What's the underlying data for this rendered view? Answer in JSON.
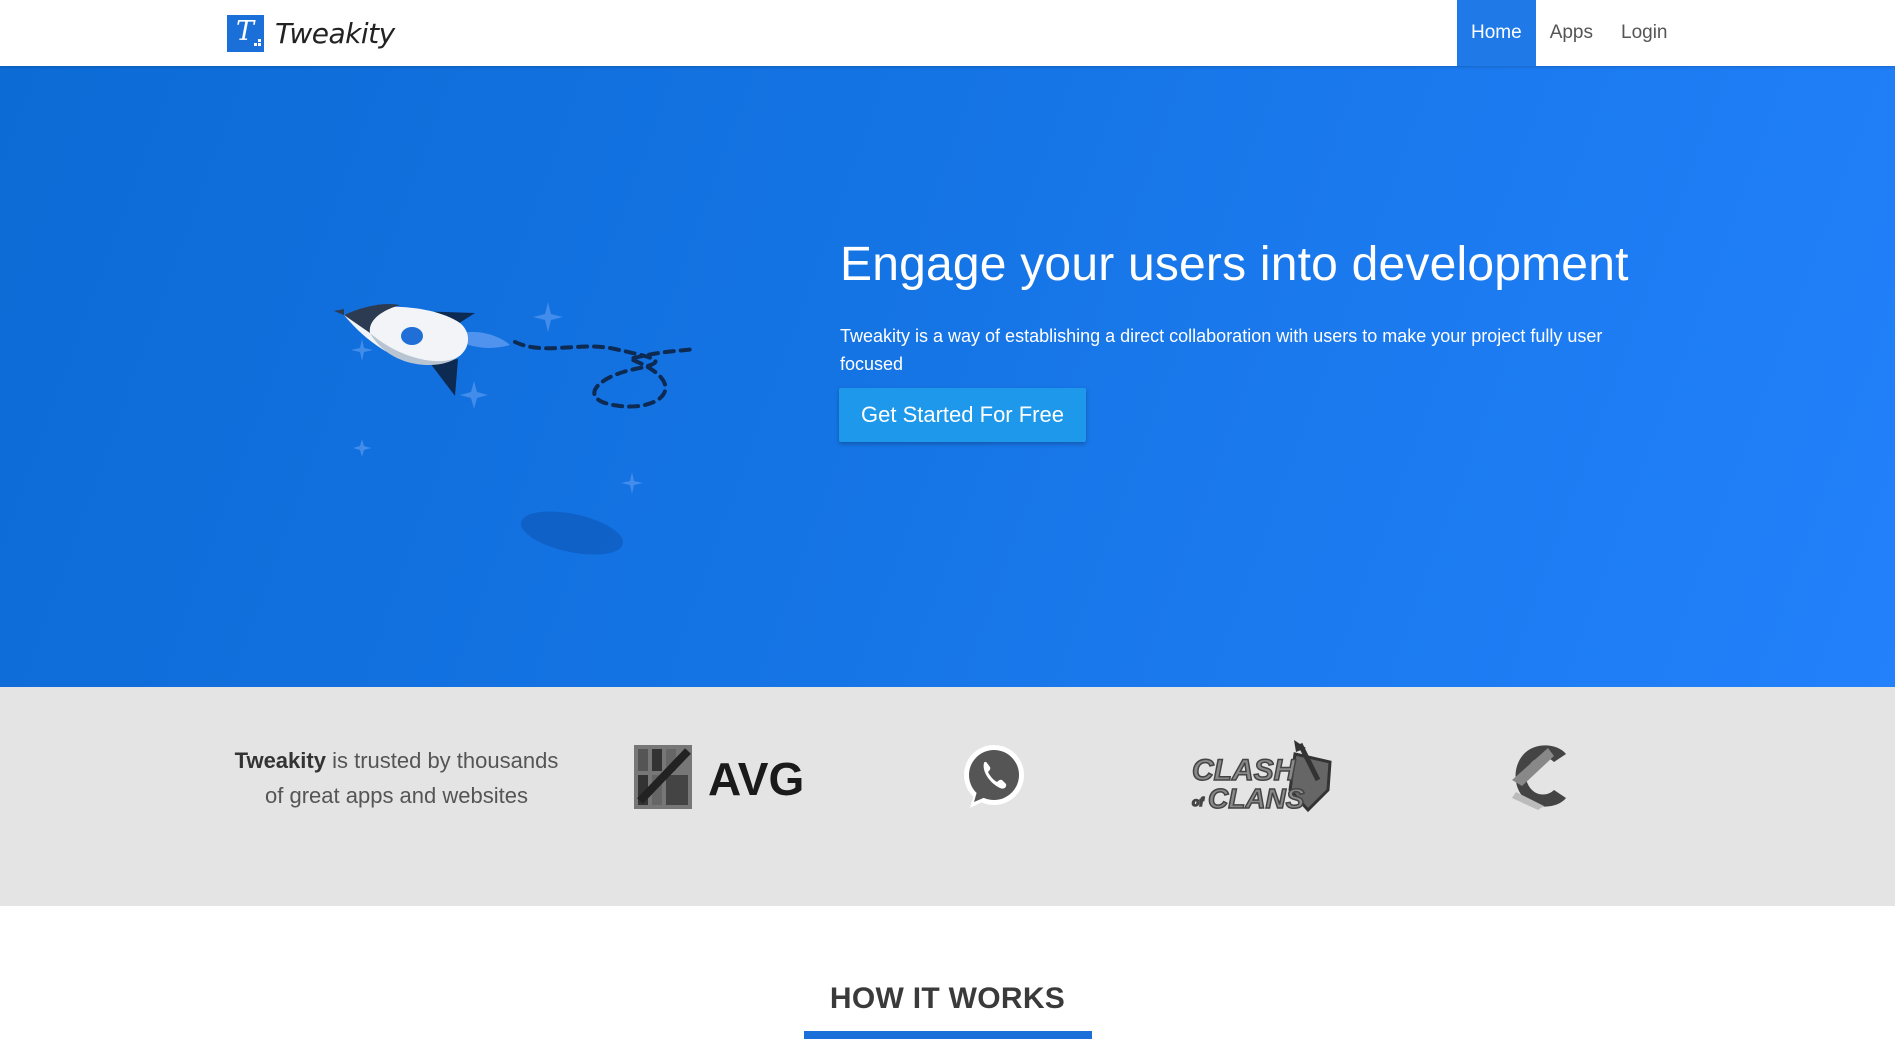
{
  "navbar": {
    "brand_mark": "T",
    "brand_name": "Tweakity",
    "items": [
      {
        "label": "Home",
        "active": true
      },
      {
        "label": "Apps",
        "active": false
      },
      {
        "label": "Login",
        "active": false
      }
    ]
  },
  "hero": {
    "title": "Engage your users into development",
    "subtitle": "Tweakity is a way of establishing a direct collaboration with users to make your project fully user focused",
    "cta_label": "Get Started For Free",
    "illustration": "rocket-illustration"
  },
  "trusted": {
    "brand": "Tweakity",
    "text": " is trusted by thousands of great apps and websites",
    "logos": [
      {
        "name": "avg-logo",
        "label": "AVG"
      },
      {
        "name": "whatsapp-logo"
      },
      {
        "name": "clash-of-clans-logo",
        "label": "CLASH of CLANS"
      },
      {
        "name": "ccleaner-logo"
      }
    ]
  },
  "how_it_works": {
    "title": "HOW IT WORKS"
  },
  "colors": {
    "primary": "#1a6fd8",
    "nav_active": "#1f7ae8",
    "cta": "#1e98ea",
    "band": "#e4e4e4"
  }
}
